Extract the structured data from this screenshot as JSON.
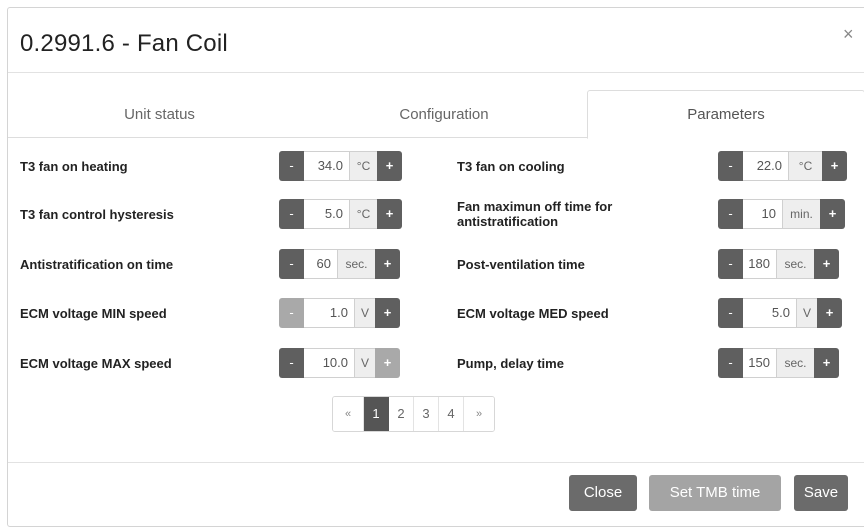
{
  "dialog": {
    "title": "0.2991.6 - Fan Coil",
    "close_glyph": "×"
  },
  "tabs": [
    {
      "label": "Unit status",
      "active": false
    },
    {
      "label": "Configuration",
      "active": false
    },
    {
      "label": "Parameters",
      "active": true
    }
  ],
  "params": {
    "left": [
      {
        "label": "T3 fan on heating",
        "value": "34.0",
        "unit": "°C",
        "minus_disabled": false,
        "plus_disabled": false
      },
      {
        "label": "T3 fan control hysteresis",
        "value": "5.0",
        "unit": "°C",
        "minus_disabled": false,
        "plus_disabled": false
      },
      {
        "label": "Antistratification on time",
        "value": "60",
        "unit": "sec.",
        "minus_disabled": false,
        "plus_disabled": false
      },
      {
        "label": "ECM voltage MIN speed",
        "value": "1.0",
        "unit": "V",
        "minus_disabled": true,
        "plus_disabled": false
      },
      {
        "label": "ECM voltage MAX speed",
        "value": "10.0",
        "unit": "V",
        "minus_disabled": false,
        "plus_disabled": true
      }
    ],
    "right": [
      {
        "label": "T3 fan on cooling",
        "value": "22.0",
        "unit": "°C",
        "minus_disabled": false,
        "plus_disabled": false
      },
      {
        "label": "Fan maximun off time for antistratification",
        "value": "10",
        "unit": "min.",
        "minus_disabled": false,
        "plus_disabled": false
      },
      {
        "label": "Post-ventilation time",
        "value": "180",
        "unit": "sec.",
        "minus_disabled": false,
        "plus_disabled": false
      },
      {
        "label": "ECM voltage MED speed",
        "value": "5.0",
        "unit": "V",
        "minus_disabled": false,
        "plus_disabled": false
      },
      {
        "label": "Pump, delay time",
        "value": "150",
        "unit": "sec.",
        "minus_disabled": false,
        "plus_disabled": false
      }
    ],
    "minus_glyph": "-",
    "plus_glyph": "+"
  },
  "pagination": {
    "prev": "«",
    "pages": [
      "1",
      "2",
      "3",
      "4"
    ],
    "active_page": "1",
    "next": "»"
  },
  "footer": {
    "close_label": "Close",
    "set_tmb_label": "Set TMB time",
    "save_label": "Save"
  },
  "colors": {
    "button_dark": "#5f5f5f",
    "button_disabled": "#a9a9a9",
    "unit_bg": "#eeeeee"
  }
}
